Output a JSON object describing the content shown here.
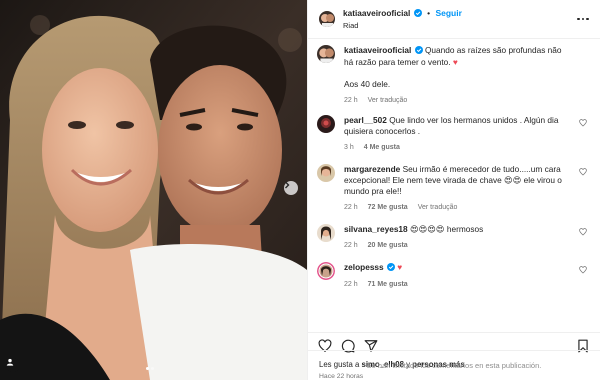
{
  "post": {
    "author": "katiaaveirooficial",
    "follow_label": "Seguir",
    "separator": "•",
    "location": "Riad",
    "caption": "Quando as raízes são profundas não há razão para temer o vento.",
    "caption_emoji": "♥",
    "caption_line2": "Aos 40 dele.",
    "caption_time": "22 h",
    "caption_translate": "Ver tradução"
  },
  "comments": [
    {
      "user": "pearl__502",
      "text": "Que lindo ver los hermanos unidos . Algún dia quisiera conocerlos .",
      "time": "3 h",
      "likes": "4 Me gusta",
      "translate": ""
    },
    {
      "user": "margarezende",
      "text": "Seu irmão é merecedor de tudo.....um cara excepcional! Ele nem teve virada de chave 😍😍 ele virou o mundo pra ele!!",
      "time": "22 h",
      "likes": "72 Me gusta",
      "translate": "Ver tradução"
    },
    {
      "user": "silvana_reyes18",
      "text": "😍😍😍😍 hermosos",
      "time": "22 h",
      "likes": "20 Me gusta",
      "translate": ""
    },
    {
      "user": "zelopesss",
      "text": "♥",
      "time": "22 h",
      "likes": "71 Me gusta",
      "translate": ""
    }
  ],
  "footer": {
    "likes_prefix": "Les gusta a",
    "likes_user": "simo_elh08",
    "likes_and": "y",
    "likes_others": "personas más",
    "time_ago": "Hace 22 horas",
    "limited_comments": "Se han limitado los comentarios en esta publicación."
  },
  "icons": {
    "like": "heart-icon",
    "comment": "comment-icon",
    "share": "share-icon",
    "save": "bookmark-icon",
    "verified": "verified-icon",
    "more": "more-icon",
    "next": "chevron-right-icon",
    "tag": "user-tag-icon"
  },
  "colors": {
    "accent": "#0095f6",
    "heart_red": "#ed4956",
    "muted": "#737373",
    "border": "#efefef"
  },
  "carousel": {
    "current": 1,
    "total": 2
  }
}
